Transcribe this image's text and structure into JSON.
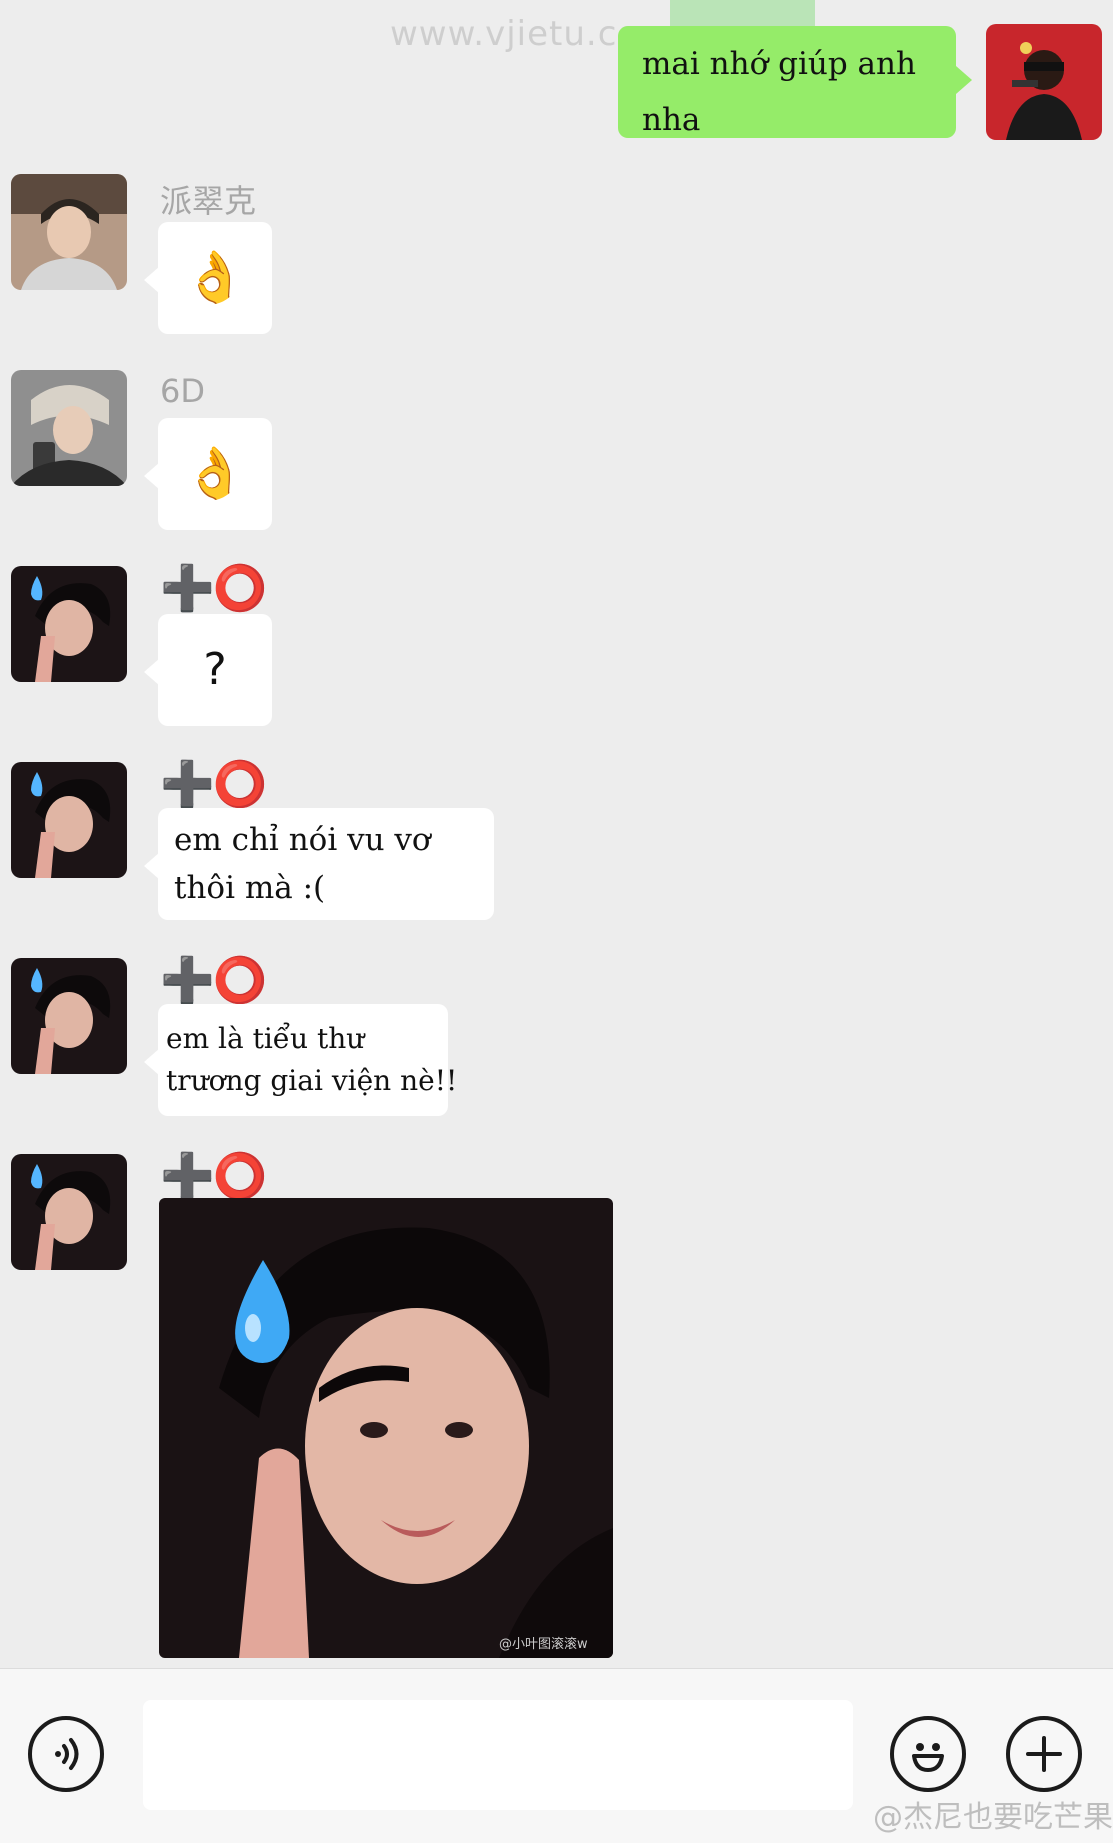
{
  "watermark": {
    "top": "www.vjietu.com",
    "bottom": "@杰尼也要吃芒果"
  },
  "messages": [
    {
      "sender": "me",
      "text": "mai nhớ giúp anh nha"
    },
    {
      "sender": "派翠克",
      "text": "👌"
    },
    {
      "sender": "6D",
      "text": "👌"
    },
    {
      "sender": "➕⭕",
      "text": "?"
    },
    {
      "sender": "➕⭕",
      "text": "em chỉ nói vu vơ thôi mà :("
    },
    {
      "sender": "➕⭕",
      "text": "em là tiểu thư trương giai viện nè!!"
    },
    {
      "sender": "➕⭕",
      "image": "sticker-sweat-drop",
      "caption": "@小叶图滚滚w"
    }
  ],
  "names": {
    "n1": "派翠克",
    "n2": "6D",
    "n3": "➕⭕"
  },
  "texts": {
    "m1": "mai nhớ giúp anh nha",
    "m2": "👌",
    "m3": "👌",
    "m4": "?",
    "m5_line1": "em chỉ nói vu vơ",
    "m5_line2": "thôi mà :(",
    "m6_line1": "em là tiểu thư",
    "m6_line2": "trương giai viện nè!!",
    "sticker_caption": "@小叶图滚滚w"
  },
  "bottom_bar": {
    "voice_icon": "voice-icon",
    "emoji_icon": "emoji-icon",
    "plus_icon": "plus-icon",
    "input_value": ""
  },
  "colors": {
    "background": "#ededed",
    "my_bubble": "#95ec69",
    "other_bubble": "#ffffff"
  }
}
